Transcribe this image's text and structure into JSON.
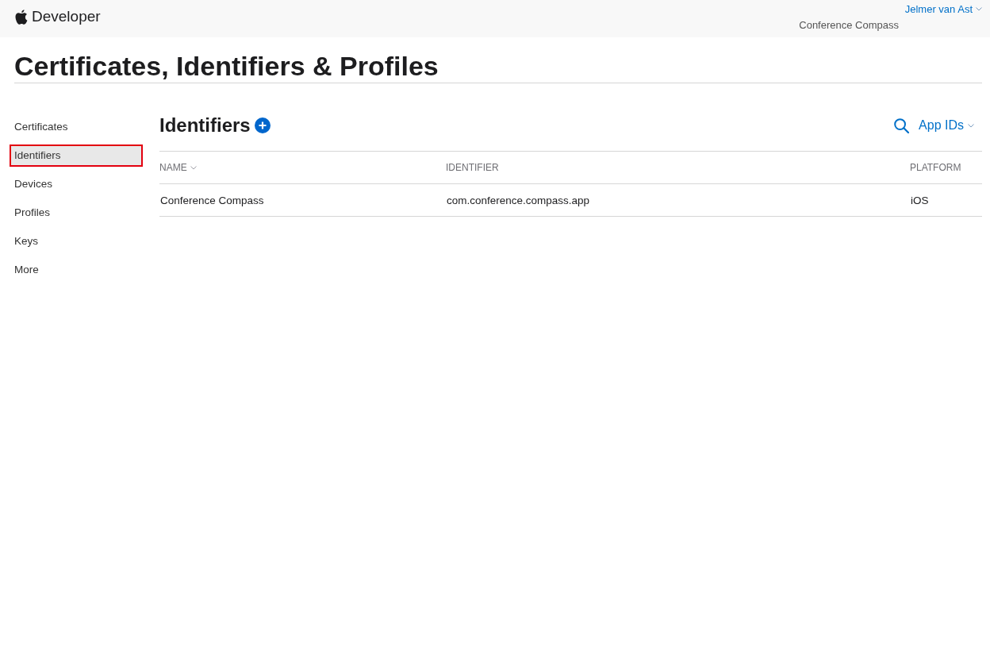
{
  "header": {
    "brand": "Developer",
    "account": {
      "name": "Jelmer van Ast",
      "team": "Conference Compass"
    }
  },
  "page_title": "Certificates, Identifiers & Profiles",
  "sidebar": {
    "items": [
      {
        "label": "Certificates",
        "selected": false,
        "callout": false
      },
      {
        "label": "Identifiers",
        "selected": true,
        "callout": true
      },
      {
        "label": "Devices",
        "selected": false,
        "callout": false
      },
      {
        "label": "Profiles",
        "selected": false,
        "callout": false
      },
      {
        "label": "Keys",
        "selected": false,
        "callout": false
      },
      {
        "label": "More",
        "selected": false,
        "callout": false
      }
    ]
  },
  "section": {
    "title": "Identifiers",
    "filter": "App IDs"
  },
  "table": {
    "columns": [
      {
        "label": "NAME",
        "sorted": true
      },
      {
        "label": "IDENTIFIER",
        "sorted": false
      },
      {
        "label": "PLATFORM",
        "sorted": false
      }
    ],
    "rows": [
      [
        "Conference Compass",
        "com.conference.compass.app",
        "iOS"
      ]
    ]
  }
}
